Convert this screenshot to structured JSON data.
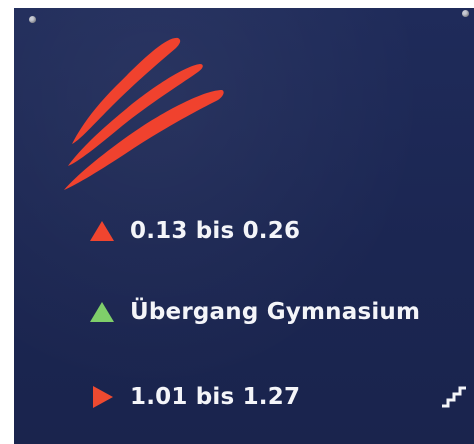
{
  "colors": {
    "panel": "#1d2855",
    "logo": "#f0422e",
    "marker_up_red": "#f0452f",
    "marker_up_green": "#7fcf6a",
    "marker_right_red": "#ee4a30",
    "text": "#f4f5f9"
  },
  "rows": [
    {
      "label": "0.13 bis 0.26",
      "marker": "triangle-up",
      "marker_color": "red"
    },
    {
      "label": "Übergang Gymnasium",
      "marker": "triangle-up",
      "marker_color": "green"
    },
    {
      "label": "1.01 bis 1.27",
      "marker": "triangle-right",
      "marker_color": "red"
    }
  ],
  "icons": {
    "logo": "red-stripes-logo",
    "stairs": "stairs-icon"
  }
}
